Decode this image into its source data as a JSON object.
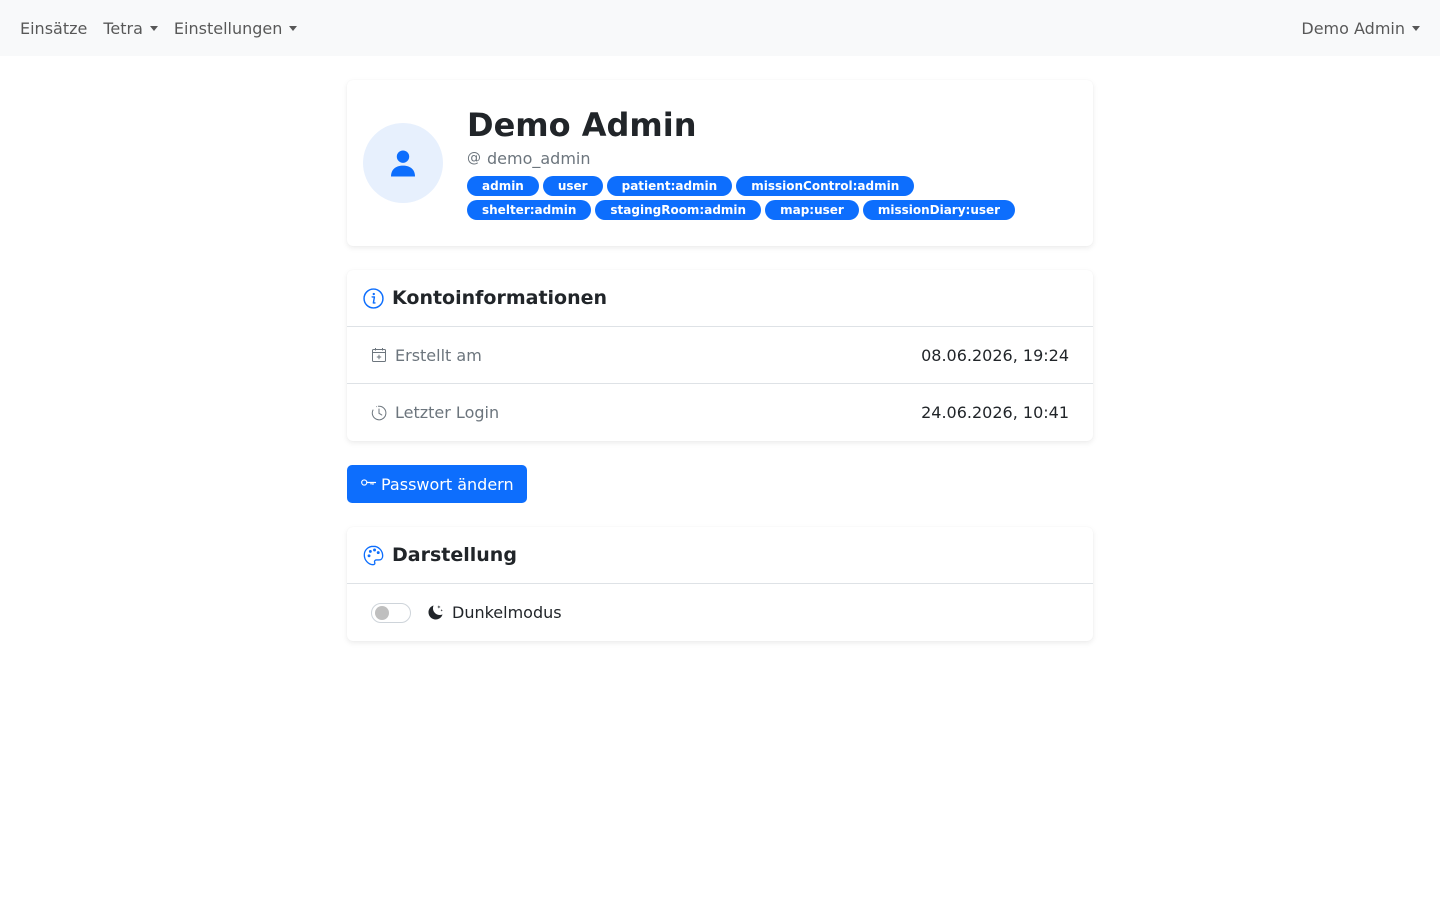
{
  "navbar": {
    "items": [
      {
        "label": "Einsätze",
        "dropdown": false
      },
      {
        "label": "Tetra",
        "dropdown": true
      },
      {
        "label": "Einstellungen",
        "dropdown": true
      }
    ],
    "user_menu": {
      "label": "Demo Admin",
      "dropdown": true
    }
  },
  "profile": {
    "icon": "person-icon",
    "name": "Demo Admin",
    "username": "demo_admin",
    "roles": [
      "admin",
      "user",
      "patient:admin",
      "missionControl:admin",
      "shelter:admin",
      "stagingRoom:admin",
      "map:user",
      "missionDiary:user"
    ]
  },
  "account": {
    "title": "Kontoinformationen",
    "icon": "info-circle-icon",
    "rows": [
      {
        "label": "Erstellt am",
        "value": "08.06.2026, 19:24",
        "icon": "calendar-plus-icon"
      },
      {
        "label": "Letzter Login",
        "value": "24.06.2026, 10:41",
        "icon": "clock-icon"
      }
    ]
  },
  "change_password": {
    "label": "Passwort ändern",
    "icon": "key-icon"
  },
  "appearance": {
    "title": "Darstellung",
    "icon": "palette-icon",
    "dark_mode": {
      "label": "Dunkelmodus",
      "enabled": false,
      "icon": "moon-stars-icon"
    }
  },
  "colors": {
    "primary": "#0d6efd",
    "navbar_bg": "#f8f9fa",
    "muted": "#6c757d"
  }
}
